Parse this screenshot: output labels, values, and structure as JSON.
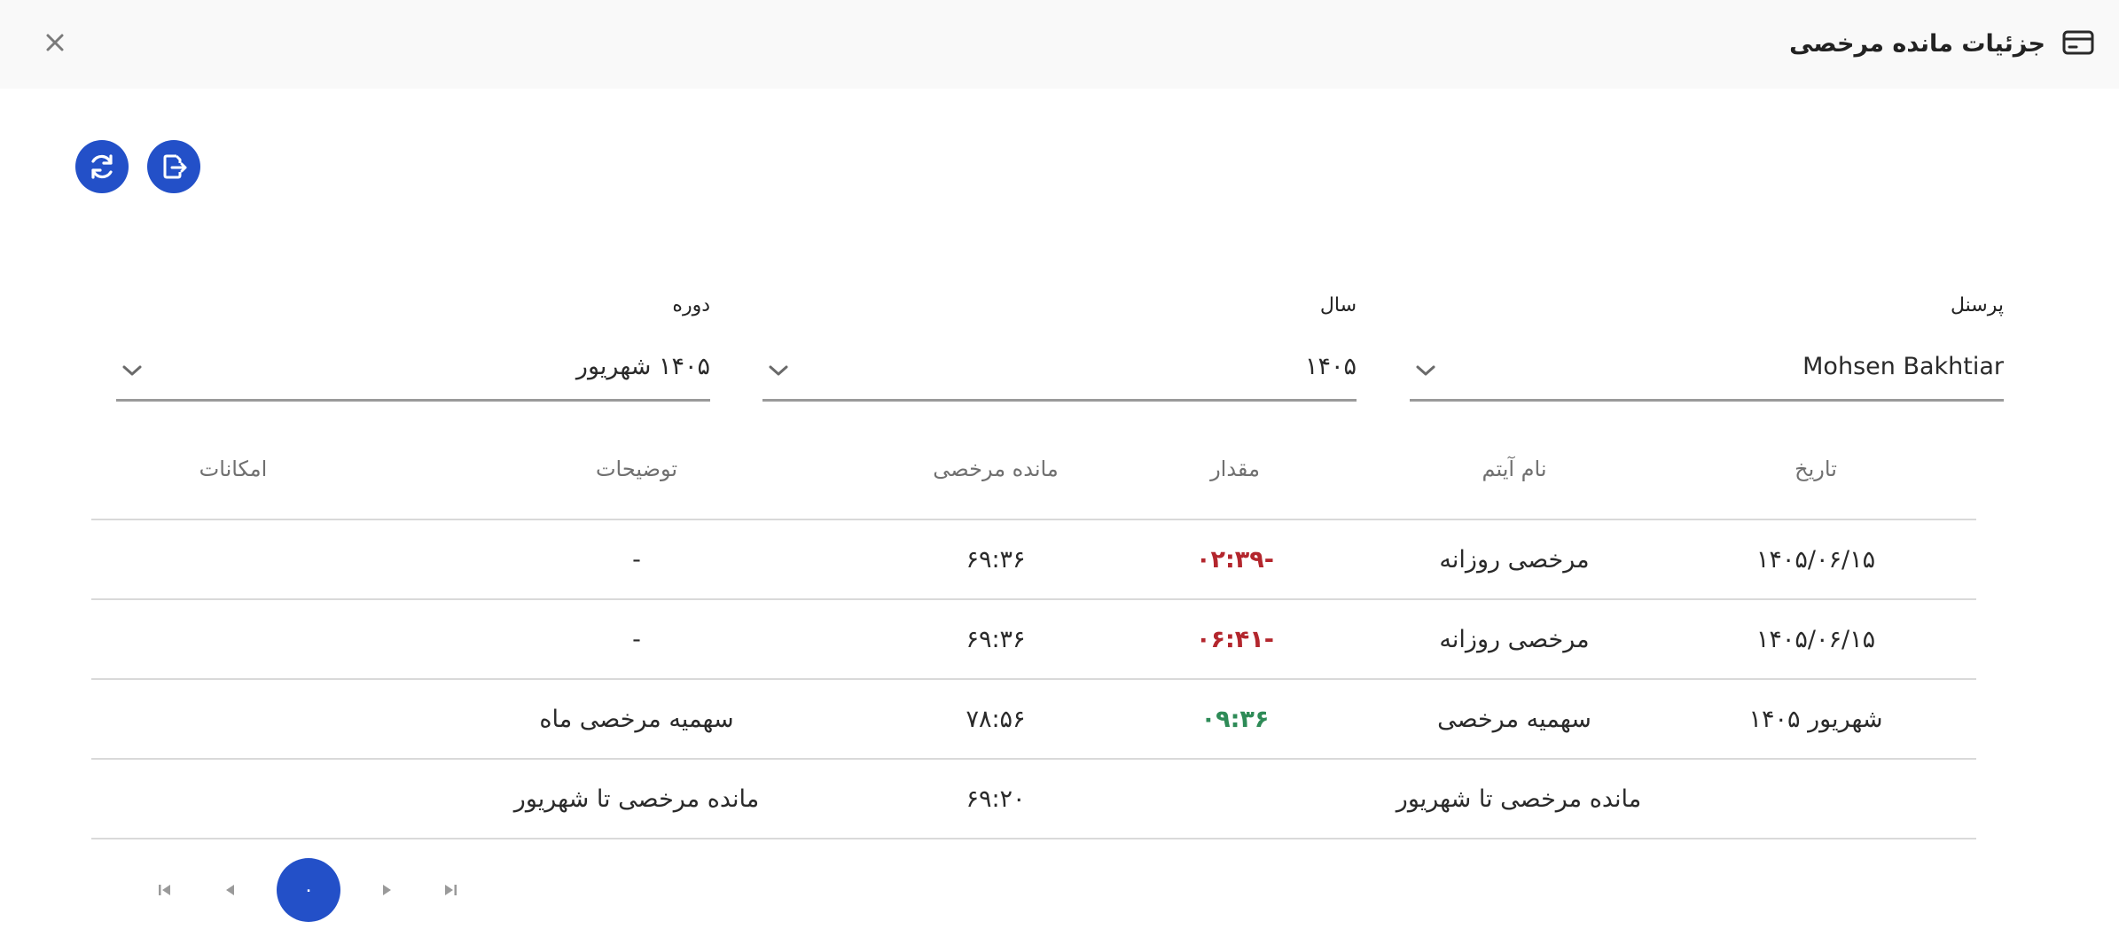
{
  "dialog": {
    "title": "جزئیات مانده مرخصی",
    "close_symbol": "✕",
    "title_icon": "credit-card-icon"
  },
  "actions": {
    "refresh_icon": "refresh-icon",
    "export_icon": "export-file-icon"
  },
  "filters": {
    "personnel": {
      "label": "پرسنل",
      "value": "Mohsen Bakhtiar"
    },
    "year": {
      "label": "سال",
      "value": "۱۴۰۵"
    },
    "period": {
      "label": "دوره",
      "value": "۱۴۰۵ شهریور"
    }
  },
  "table": {
    "headers": {
      "date": "تاریخ",
      "item_name": "نام آیتم",
      "amount": "مقدار",
      "remaining": "مانده مرخصی",
      "description": "توضیحات",
      "options": "امکانات"
    },
    "rows": [
      {
        "date": "۱۴۰۵/۰۶/۱۵",
        "item_name": "مرخصی روزانه",
        "amount": "-۰۲:۳۹",
        "remaining": "۶۹:۳۶",
        "description": "-"
      },
      {
        "date": "۱۴۰۵/۰۶/۱۵",
        "item_name": "مرخصی روزانه",
        "amount": "-۰۶:۴۱",
        "remaining": "۶۹:۳۶",
        "description": "-"
      },
      {
        "date": "شهریور ۱۴۰۵",
        "item_name": "سهمیه مرخصی",
        "amount": "۰۹:۳۶",
        "remaining": "۷۸:۵۶",
        "description": "سهمیه مرخصی ماه"
      },
      {
        "summary_label": "مانده مرخصی تا شهریور",
        "remaining": "۶۹:۲۰",
        "description": "مانده مرخصی تا شهریور"
      }
    ]
  },
  "pagination": {
    "current_page": "۰"
  },
  "colors": {
    "accent": "#2350c8",
    "negative": "#b3262d",
    "positive": "#2e8b57",
    "header_bg": "#f9f9f9"
  }
}
